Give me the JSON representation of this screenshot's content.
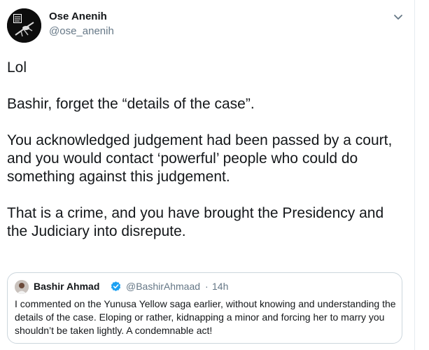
{
  "tweet": {
    "author": {
      "name": "Ose Anenih",
      "handle": "@ose_anenih",
      "avatar_icon": "avatar-photo-icon"
    },
    "menu_icon": "chevron-down-icon",
    "paragraphs": [
      "Lol",
      "Bashir, forget the “details of the case”.",
      "You acknowledged judgement had been passed by a court, and you would contact ‘powerful’ people who could do something against this judgement.",
      "That is a crime, and you have brought the Presidency and the Judiciary into disrepute."
    ]
  },
  "quoted_tweet": {
    "author": {
      "name": "Bashir Ahmad",
      "handle": "@BashirAhmaad",
      "verified_icon": "verified-badge-icon"
    },
    "separator": "·",
    "time": "14h",
    "text": "I commented on the Yunusa Yellow saga earlier, without knowing and understanding the details of the case. Eloping or rather, kidnapping a minor and forcing her to marry you shouldn’t be taken lightly. A condemnable act!"
  },
  "colors": {
    "text_primary": "#14171a",
    "text_secondary": "#657786",
    "verified_blue": "#1da1f2",
    "border": "#ccd6dd"
  }
}
